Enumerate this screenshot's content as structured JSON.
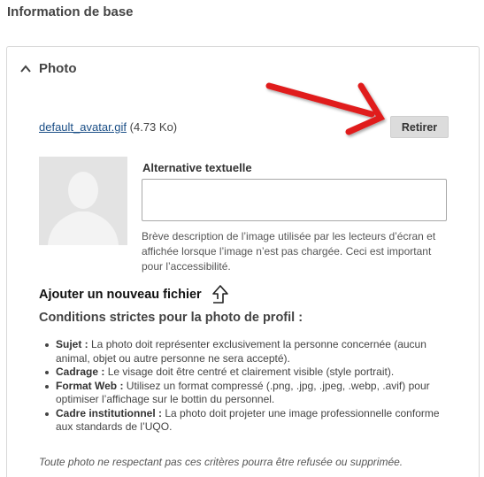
{
  "section": {
    "title": "Information de base"
  },
  "photo_panel": {
    "summary_label": "Photo",
    "file": {
      "name": "default_avatar.gif",
      "size": "(4.73 Ko)"
    },
    "remove_label": "Retirer",
    "alt": {
      "label": "Alternative textuelle",
      "value": "",
      "description": "Brève description de l’image utilisée par les lecteurs d’écran et affichée lorsque l’image n’est pas chargée. Ceci est important pour l’accessibilité."
    },
    "add_file_label": "Ajouter un nouveau fichier",
    "conditions_title": "Conditions strictes pour la photo de profil :",
    "rules": [
      {
        "term": "Sujet :",
        "text": " La photo doit représenter exclusivement la personne concernée (aucun animal, objet ou autre personne ne sera accepté)."
      },
      {
        "term": "Cadrage :",
        "text": " Le visage doit être centré et clairement visible (style portrait)."
      },
      {
        "term": "Format Web :",
        "text": " Utilisez un format compressé (.png, .jpg, .jpeg, .webp, .avif) pour optimiser l’affichage sur le bottin du personnel."
      },
      {
        "term": "Cadre institutionnel :",
        "text": " La photo doit projeter une image professionnelle conforme aux standards de l’UQO."
      }
    ],
    "note": "Toute photo ne respectant pas ces critères pourra être refusée ou supprimée."
  },
  "colors": {
    "link": "#1a4e86",
    "annotation_arrow": "#e01b1b",
    "button_bg": "#dcdcdc"
  }
}
